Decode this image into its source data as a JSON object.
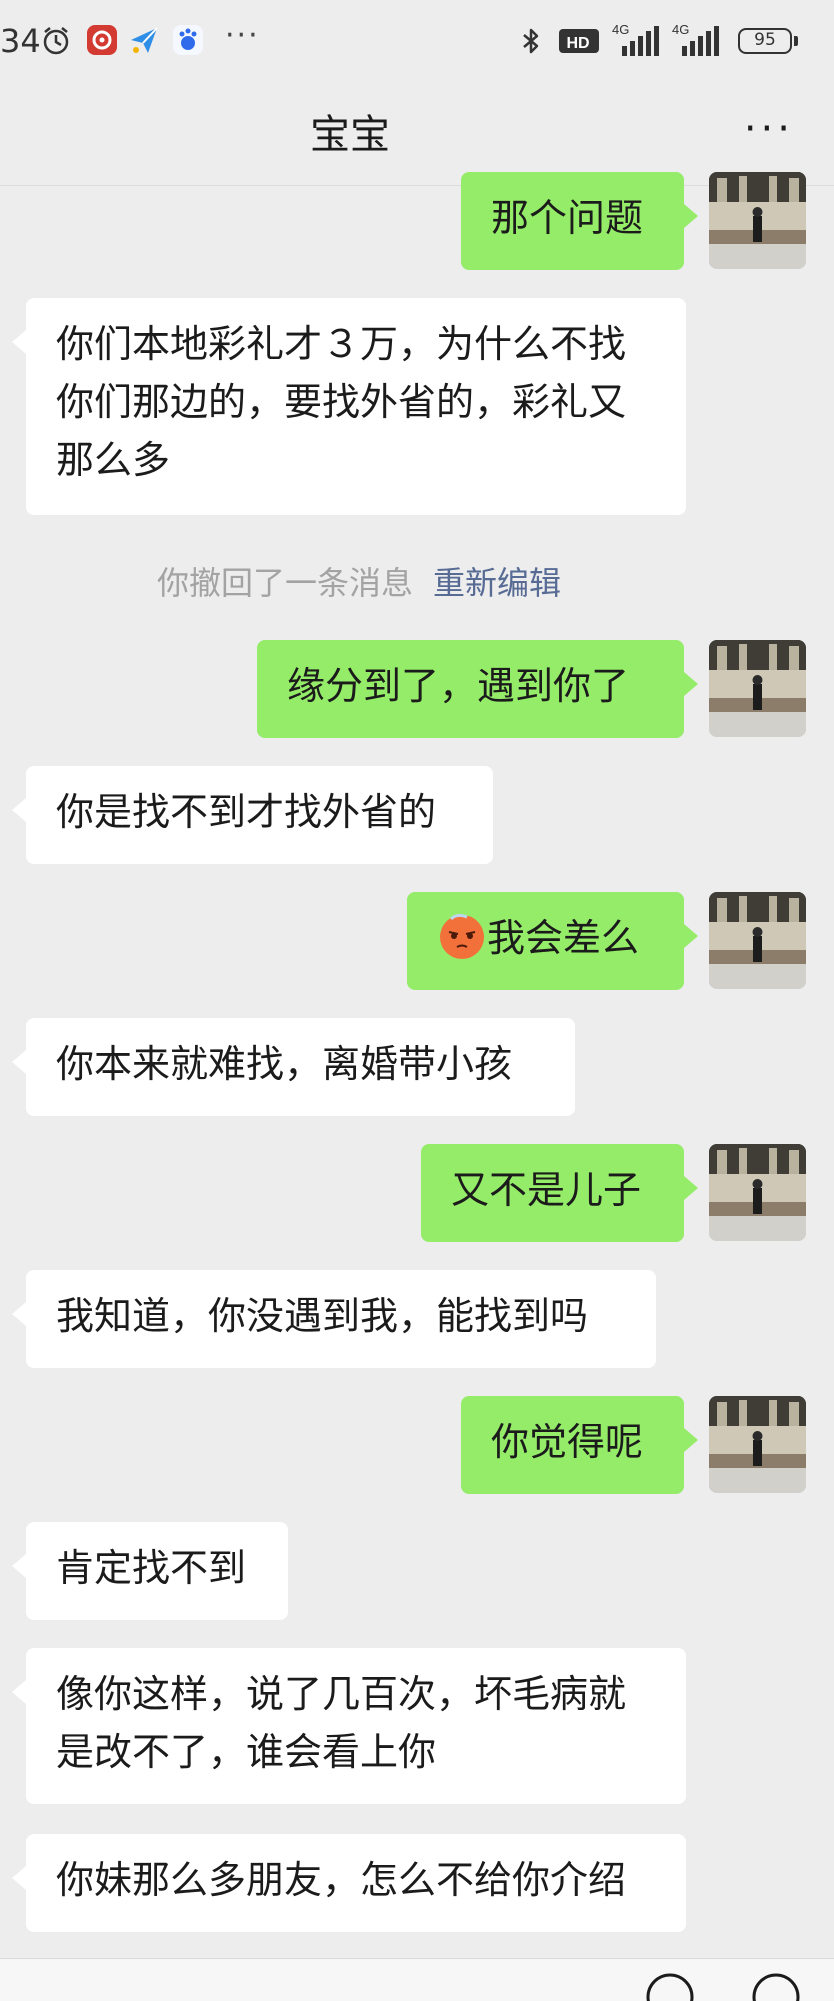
{
  "status_bar": {
    "time": "34",
    "battery": "95",
    "network1": "4G",
    "network2": "4G",
    "hd": "HD"
  },
  "nav": {
    "title": "宝宝",
    "more": "···"
  },
  "system": {
    "recall_text": "你撤回了一条消息",
    "reedit_link": "重新编辑"
  },
  "messages": [
    {
      "side": "sent",
      "text": "那个问题"
    },
    {
      "side": "recv",
      "text": "你们本地彩礼才３万，为什么不找你们那边的，要找外省的，彩礼又那么多"
    },
    {
      "side": "sent",
      "text": "缘分到了，遇到你了"
    },
    {
      "side": "recv",
      "text": "你是找不到才找外省的"
    },
    {
      "side": "sent",
      "text": "我会差么",
      "emoji": "blushing-sweat-emoji"
    },
    {
      "side": "recv",
      "text": "你本来就难找，离婚带小孩"
    },
    {
      "side": "sent",
      "text": "又不是儿子"
    },
    {
      "side": "recv",
      "text": "我知道，你没遇到我，能找到吗"
    },
    {
      "side": "sent",
      "text": "你觉得呢"
    },
    {
      "side": "recv",
      "text": "肯定找不到"
    },
    {
      "side": "recv",
      "text": "像你这样，说了几百次，坏毛病就是改不了，谁会看上你"
    },
    {
      "side": "recv",
      "text": "你妹那么多朋友，怎么不给你介绍"
    }
  ]
}
